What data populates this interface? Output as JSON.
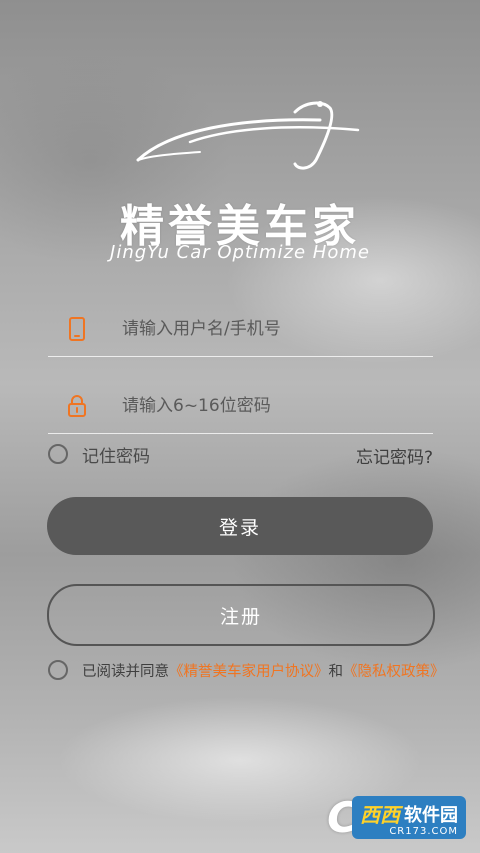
{
  "brand": {
    "name_cn": "精誉美车家",
    "name_en": "JingYu Car Optimize Home"
  },
  "login_form": {
    "phone_placeholder": "请输入用户名/手机号",
    "password_placeholder": "请输入6~16位密码",
    "remember_label": "记住密码",
    "forgot_label": "忘记密码?",
    "login_button": "登录",
    "register_button": "注册"
  },
  "agreement": {
    "prefix": "已阅读并同意",
    "user_agreement": "《精誉美车家用户协议》",
    "and": "和",
    "privacy_policy": "《隐私权政策》"
  },
  "watermark": {
    "glyph": "C",
    "xixi": "西西",
    "soft": "软件园",
    "url": "CR173.COM"
  },
  "icons": {
    "phone": "phone-icon",
    "lock": "lock-icon"
  },
  "colors": {
    "accent": "#f07522",
    "login_button": "#595959",
    "watermark_blue": "#2d7fc1"
  }
}
